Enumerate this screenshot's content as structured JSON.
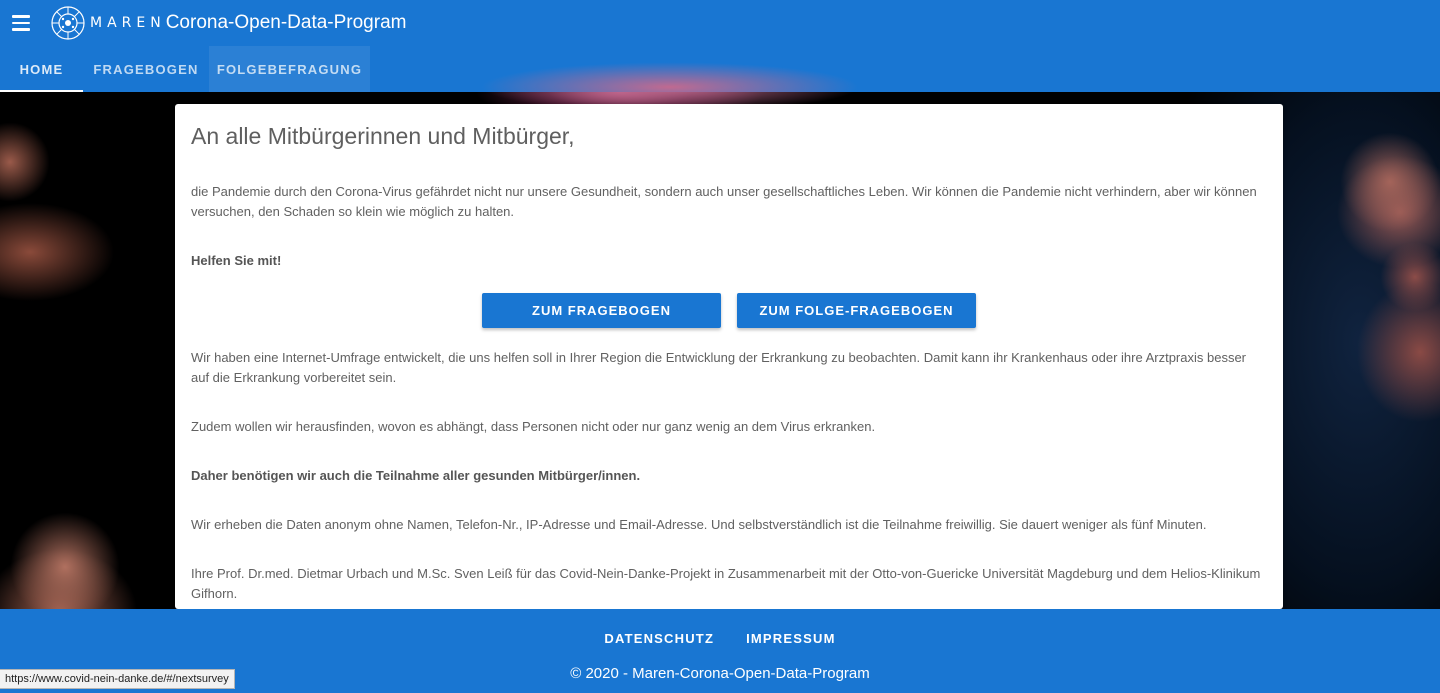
{
  "header": {
    "brand": "MAREN",
    "title": "Corona-Open-Data-Program",
    "menu_icon": "hamburger-menu-icon",
    "logo_icon": "virus-logo-icon"
  },
  "tabs": [
    {
      "label": "HOME",
      "active": true
    },
    {
      "label": "FRAGEBOGEN",
      "active": false
    },
    {
      "label": "FOLGEBEFRAGUNG",
      "active": false
    }
  ],
  "content": {
    "heading": "An alle Mitbürgerinnen und Mitbürger,",
    "intro": "die Pandemie durch den Corona-Virus gefährdet nicht nur unsere Gesundheit, sondern auch unser gesellschaftliches Leben. Wir können die Pandemie nicht verhindern, aber wir können versuchen, den Schaden so klein wie möglich zu halten.",
    "help": "Helfen Sie mit!",
    "button_survey": "ZUM FRAGEBOGEN",
    "button_followup": "ZUM FOLGE-FRAGEBOGEN",
    "p_umfrage": "Wir haben eine Internet-Umfrage entwickelt, die uns helfen soll in Ihrer Region die Entwicklung der Erkrankung zu beobachten. Damit kann ihr Krankenhaus oder ihre Arztpraxis besser auf die Erkrankung vorbereitet sein.",
    "p_zudem": "Zudem wollen wir herausfinden, wovon es abhängt, dass Personen nicht oder nur ganz wenig an dem Virus erkranken.",
    "p_daher": "Daher benötigen wir auch die Teilnahme aller gesunden Mitbürger/innen.",
    "p_anonym": "Wir erheben die Daten anonym ohne Namen, Telefon-Nr., IP-Adresse und Email-Adresse. Und selbstverständlich ist die Teilnahme freiwillig. Sie dauert weniger als fünf Minuten.",
    "p_signature": "Ihre Prof. Dr.med. Dietmar Urbach und M.Sc. Sven Leiß für das Covid-Nein-Danke-Projekt in Zusammenarbeit mit der Otto-von-Guericke Universität Magdeburg und dem Helios-Klinikum Gifhorn."
  },
  "footer": {
    "link_privacy": "DATENSCHUTZ",
    "link_imprint": "IMPRESSUM",
    "copyright": "© 2020 - Maren-Corona-Open-Data-Program"
  },
  "statusbar": {
    "url": "https://www.covid-nein-danke.de/#/nextsurvey"
  },
  "colors": {
    "primary": "#1976d2",
    "text": "#616161",
    "card": "#ffffff"
  }
}
